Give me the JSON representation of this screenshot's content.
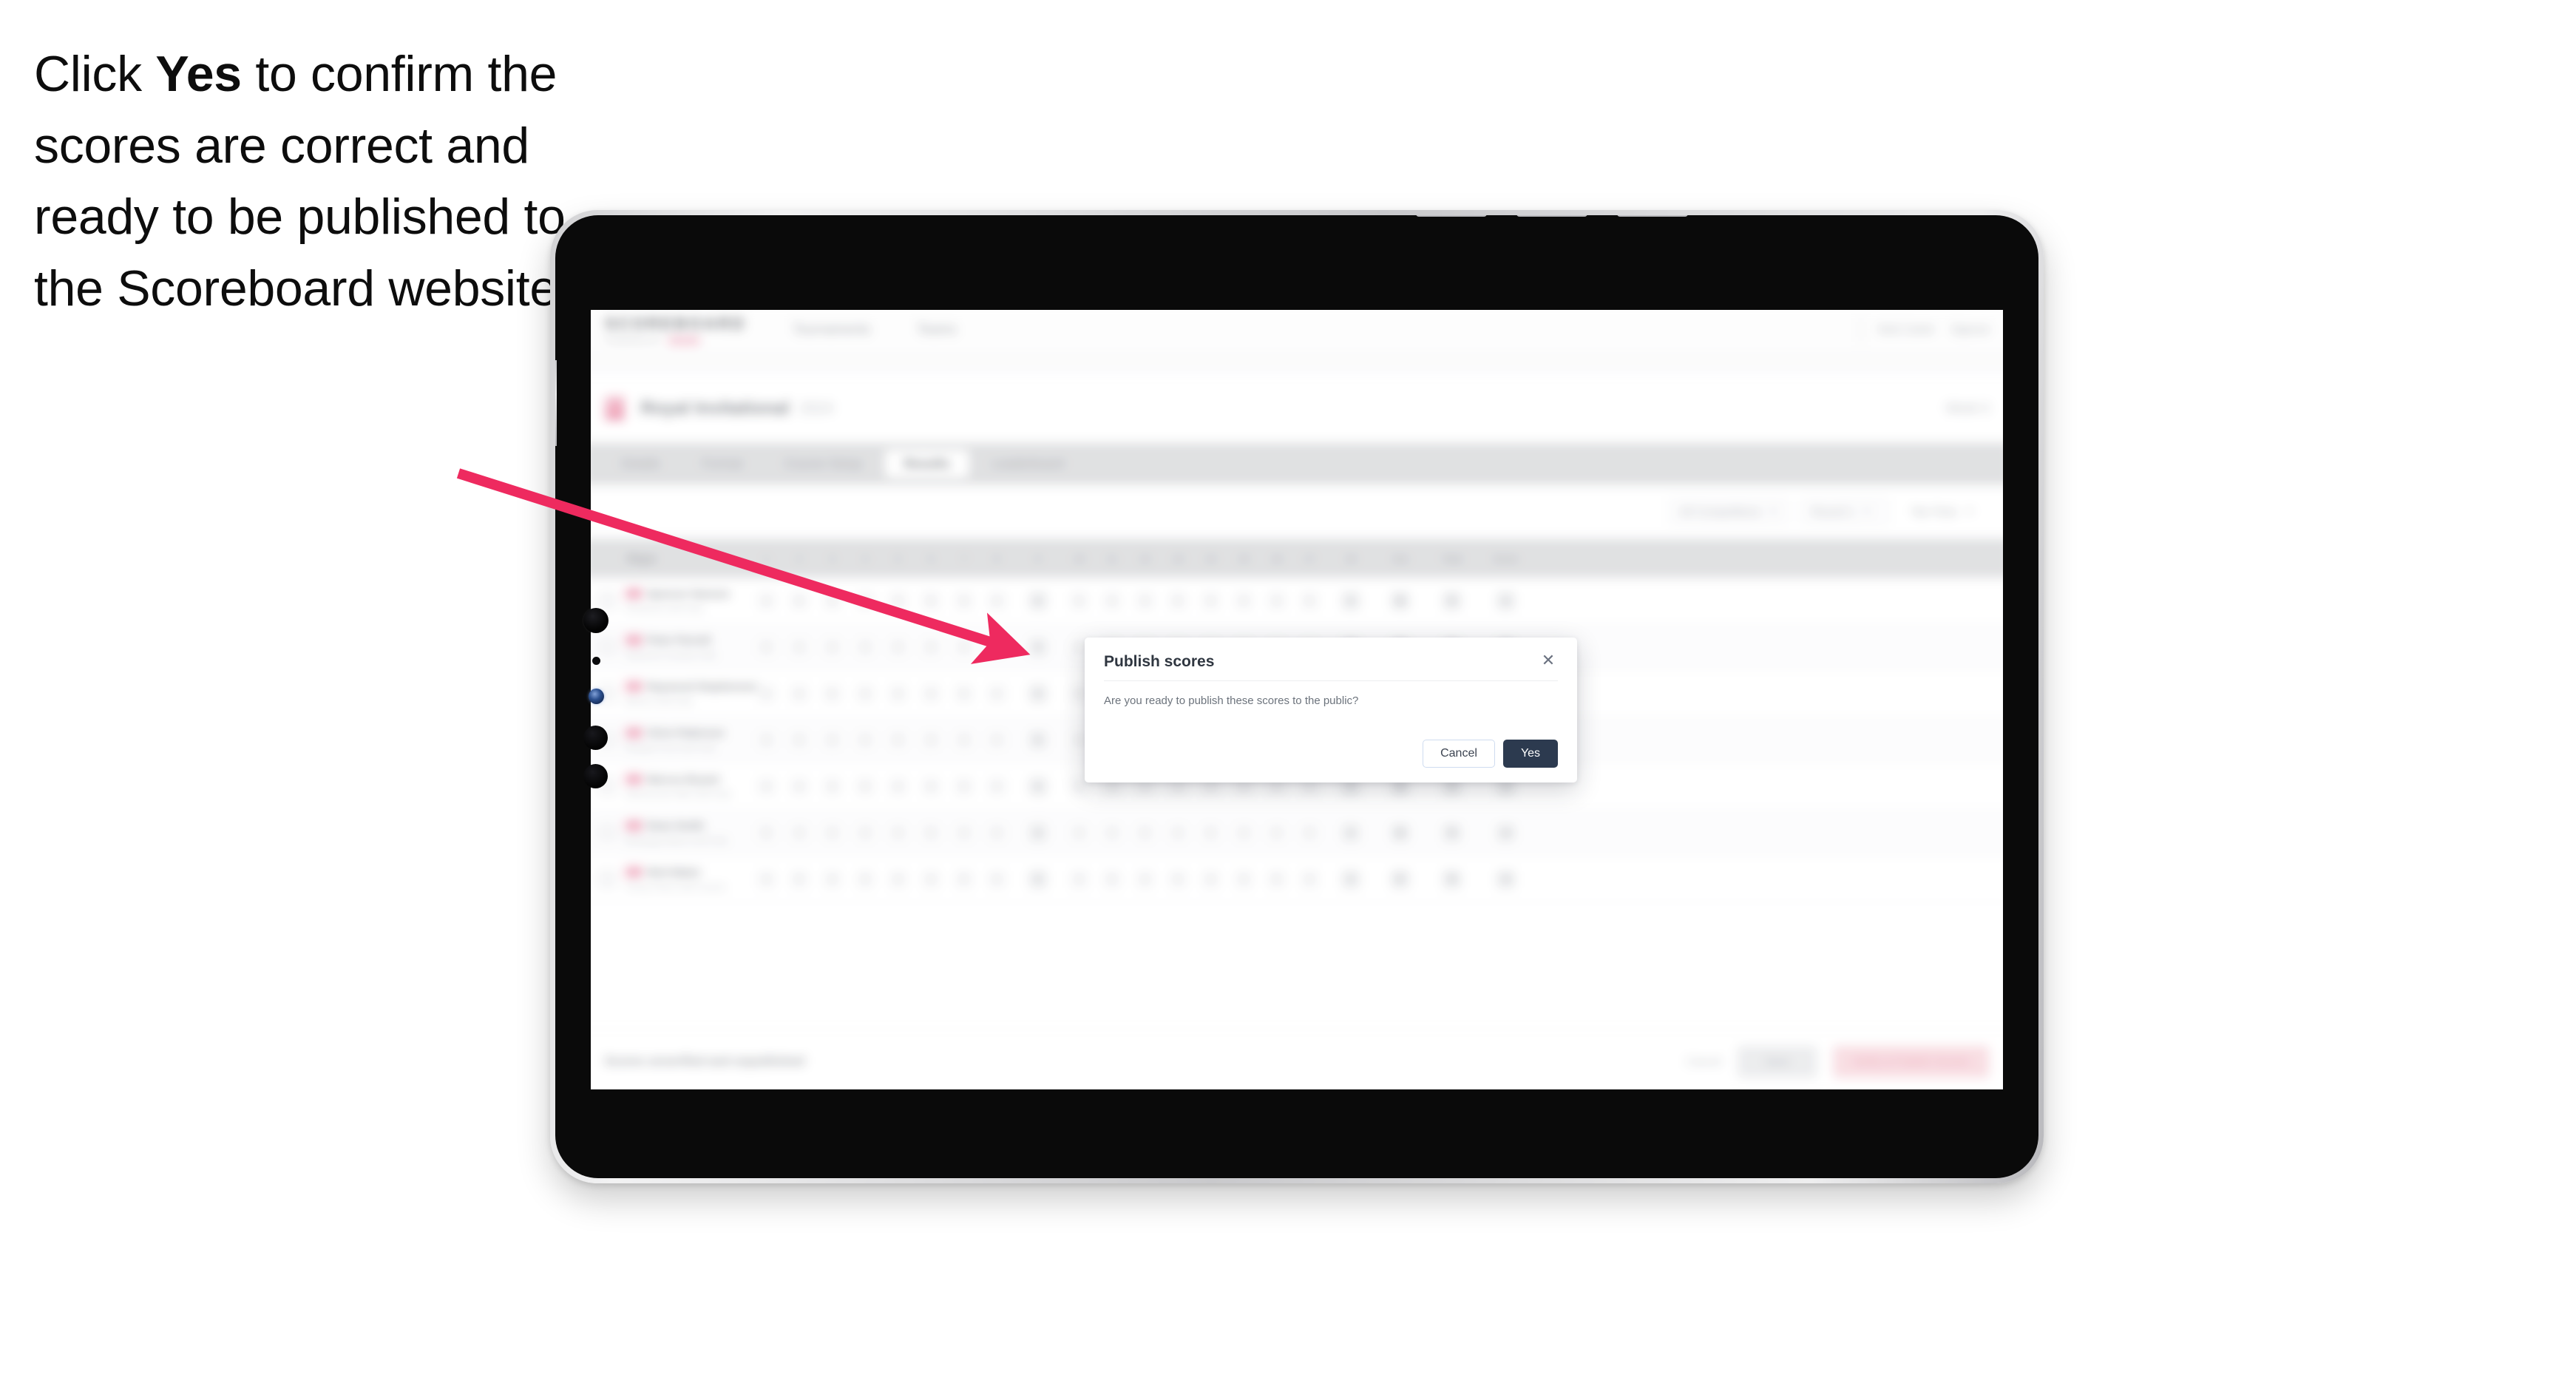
{
  "instruction": {
    "before": "Click ",
    "bold": "Yes",
    "after": " to confirm the scores are correct and ready to be published to the Scoreboard website."
  },
  "colors": {
    "arrow": "#EE2A5F",
    "modal_primary": "#2C3A4F",
    "brand_pink": "#EF4A78",
    "device_frame": "#CACACD",
    "device_bezel": "#0A0A0A"
  },
  "app": {
    "brand": {
      "wordmark": "SCOREBOARD",
      "subtext": "POWERED BY",
      "sub_badge": ""
    },
    "topnav": [
      {
        "label": "Tournaments"
      },
      {
        "label": "Teams"
      }
    ],
    "topbar_right": [
      {
        "label": "Nick Carter"
      },
      {
        "label": "Signout"
      }
    ],
    "breadcrumb": "",
    "event": {
      "title": "Royal Invitational",
      "subtitle": "2024",
      "meta": "Week 3"
    },
    "tabs": [
      {
        "label": "Details",
        "active": false
      },
      {
        "label": "Format",
        "active": false
      },
      {
        "label": "Course Setup",
        "active": false
      },
      {
        "label": "Results",
        "active": true
      },
      {
        "label": "Leaderboard",
        "active": false
      }
    ],
    "filters": {
      "competition": "All Competitions",
      "round": "Round 1",
      "tee_time": "Tee Time"
    },
    "table": {
      "columns": [
        {
          "label": "Player",
          "type": "player"
        },
        {
          "label": "1",
          "type": "hole"
        },
        {
          "label": "2",
          "type": "hole"
        },
        {
          "label": "3",
          "type": "hole"
        },
        {
          "label": "4",
          "type": "hole"
        },
        {
          "label": "5",
          "type": "hole"
        },
        {
          "label": "6",
          "type": "hole"
        },
        {
          "label": "7",
          "type": "hole"
        },
        {
          "label": "8",
          "type": "hole"
        },
        {
          "label": "9",
          "type": "wide"
        },
        {
          "label": "10",
          "type": "hole"
        },
        {
          "label": "11",
          "type": "hole"
        },
        {
          "label": "12",
          "type": "hole"
        },
        {
          "label": "13",
          "type": "hole"
        },
        {
          "label": "14",
          "type": "hole"
        },
        {
          "label": "15",
          "type": "hole"
        },
        {
          "label": "16",
          "type": "hole"
        },
        {
          "label": "17",
          "type": "hole"
        },
        {
          "label": "18",
          "type": "wide"
        },
        {
          "label": "Out",
          "type": "wide"
        },
        {
          "label": "Total",
          "type": "total"
        },
        {
          "label": "Score",
          "type": "total"
        }
      ],
      "rows": [
        {
          "name": "Spencer Hanson",
          "club": "Pinehurst Golf Club",
          "scores": [
            "4",
            "5",
            "3",
            "4",
            "4",
            "5",
            "3",
            "4",
            "4",
            "5",
            "4",
            "3",
            "5",
            "4",
            "4",
            "3",
            "5",
            "4"
          ],
          "out": "36",
          "total": "72",
          "score": "+1"
        },
        {
          "name": "Peter Parnell",
          "club": "Oakmont Country Club",
          "scores": [
            "5",
            "4",
            "4",
            "3",
            "5",
            "4",
            "4",
            "5",
            "3",
            "4",
            "5",
            "4",
            "3",
            "4",
            "5",
            "4",
            "4",
            "3"
          ],
          "out": "37",
          "total": "73",
          "score": "+2"
        },
        {
          "name": "Raymond Stephenson",
          "club": "Merion Golf Club",
          "scores": [
            "4",
            "4",
            "5",
            "4",
            "3",
            "4",
            "5",
            "4",
            "4",
            "3",
            "4",
            "5",
            "4",
            "4",
            "3",
            "5",
            "4",
            "4"
          ],
          "out": "37",
          "total": "73",
          "score": "+2"
        },
        {
          "name": "Chris Patterson",
          "club": "Winged Foot Golf Club",
          "scores": [
            "3",
            "5",
            "4",
            "4",
            "5",
            "3",
            "4",
            "4",
            "5",
            "4",
            "4",
            "3",
            "5",
            "4",
            "5",
            "4",
            "3",
            "4"
          ],
          "out": "37",
          "total": "74",
          "score": "+3"
        },
        {
          "name": "Marcus Bryant",
          "club": "Shinnecock Hills Golf Club",
          "scores": [
            "4",
            "4",
            "3",
            "5",
            "4",
            "4",
            "5",
            "3",
            "4",
            "5",
            "4",
            "4",
            "3",
            "4",
            "5",
            "4",
            "4",
            "5"
          ],
          "out": "36",
          "total": "74",
          "score": "+3"
        },
        {
          "name": "Dean Smith",
          "club": "Bethpage Black Golf Club",
          "scores": [
            "5",
            "3",
            "4",
            "4",
            "4",
            "5",
            "4",
            "4",
            "3",
            "4",
            "3",
            "5",
            "4",
            "5",
            "4",
            "4",
            "5",
            "4"
          ],
          "out": "36",
          "total": "75",
          "score": "+4"
        },
        {
          "name": "Nick Baker",
          "club": "Torrey Pines Golf Course",
          "scores": [
            "4",
            "5",
            "4",
            "3",
            "4",
            "4",
            "5",
            "4",
            "4",
            "3",
            "5",
            "4",
            "4",
            "4",
            "3",
            "5",
            "4",
            "4"
          ],
          "out": "37",
          "total": "75",
          "score": "+4"
        }
      ]
    },
    "footer": {
      "note": "Scores unverified and unpublished",
      "link": "Cancel",
      "secondary": "Save",
      "primary": "Verify & Publish Scores"
    }
  },
  "modal": {
    "title": "Publish scores",
    "body": "Are you ready to publish these scores to the public?",
    "cancel_label": "Cancel",
    "yes_label": "Yes",
    "close_glyph": "✕"
  }
}
